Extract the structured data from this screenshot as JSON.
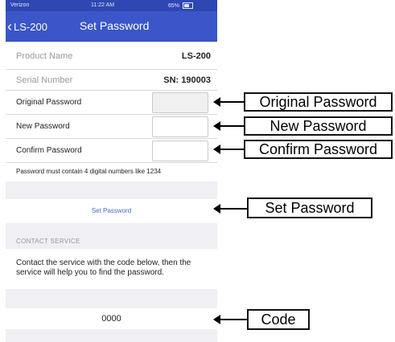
{
  "status_bar": {
    "carrier": "Verizon",
    "time": "11:22 AM",
    "battery": "65%"
  },
  "nav": {
    "back_label": "LS-200",
    "title": "Set Password"
  },
  "product": {
    "label": "Product Name",
    "value": "LS-200"
  },
  "serial": {
    "label": "Serial Number",
    "value": "SN: 190003"
  },
  "fields": {
    "original_label": "Original Password",
    "new_label": "New Password",
    "confirm_label": "Confirm Password"
  },
  "hint": "Password must contain 4 digital numbers like 1234",
  "set_button": "Set Password",
  "contact_section": "CONTACT SERVICE",
  "contact_text": "Contact the service with the code below, then the service will help you to find the password.",
  "code": "0000",
  "callouts": {
    "original": "Original Password",
    "new": "New Password",
    "confirm": "Confirm Password",
    "set": "Set Password",
    "code": "Code"
  }
}
